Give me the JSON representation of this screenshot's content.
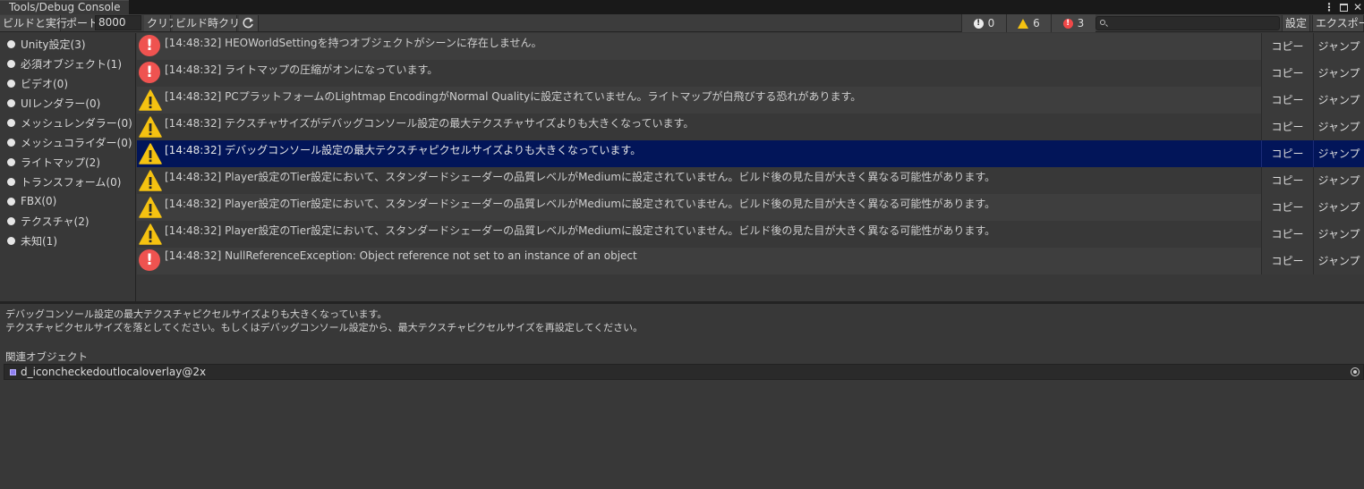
{
  "window": {
    "title": "Tools/Debug Console"
  },
  "toolbar": {
    "build_run_label": "ビルドと実行",
    "port_label": "ポート",
    "port_value": "8000",
    "clear_label": "クリア",
    "clear_on_build_label": "ビルド時クリア",
    "refresh_icon": "refresh-icon",
    "info_count": "0",
    "warning_count": "6",
    "error_count": "3",
    "search_placeholder": "",
    "settings_label": "設定",
    "export_label": "エクスポート"
  },
  "sidebar": {
    "items": [
      {
        "label": "Unity設定(3)"
      },
      {
        "label": "必須オブジェクト(1)"
      },
      {
        "label": "ビデオ(0)"
      },
      {
        "label": "UIレンダラー(0)"
      },
      {
        "label": "メッシュレンダラー(0)"
      },
      {
        "label": "メッシュコライダー(0)"
      },
      {
        "label": "ライトマップ(2)"
      },
      {
        "label": "トランスフォーム(0)"
      },
      {
        "label": "FBX(0)"
      },
      {
        "label": "テクスチャ(2)"
      },
      {
        "label": "未知(1)"
      }
    ]
  },
  "logs": {
    "copy_label": "コピー",
    "jump_label": "ジャンプ",
    "rows": [
      {
        "level": "error",
        "text": "[14:48:32] HEOWorldSettingを持つオブジェクトがシーンに存在しません。",
        "selected": false
      },
      {
        "level": "error",
        "text": "[14:48:32] ライトマップの圧縮がオンになっています。",
        "selected": false
      },
      {
        "level": "warning",
        "text": "[14:48:32] PCプラットフォームのLightmap EncodingがNormal Qualityに設定されていません。ライトマップが白飛びする恐れがあります。",
        "selected": false
      },
      {
        "level": "warning",
        "text": "[14:48:32] テクスチャサイズがデバッグコンソール設定の最大テクスチャサイズよりも大きくなっています。",
        "selected": false
      },
      {
        "level": "warning",
        "text": "[14:48:32] デバッグコンソール設定の最大テクスチャピクセルサイズよりも大きくなっています。",
        "selected": true
      },
      {
        "level": "warning",
        "text": "[14:48:32] Player設定のTier設定において、スタンダードシェーダーの品質レベルがMediumに設定されていません。ビルド後の見た目が大きく異なる可能性があります。",
        "selected": false
      },
      {
        "level": "warning",
        "text": "[14:48:32] Player設定のTier設定において、スタンダードシェーダーの品質レベルがMediumに設定されていません。ビルド後の見た目が大きく異なる可能性があります。",
        "selected": false
      },
      {
        "level": "warning",
        "text": "[14:48:32] Player設定のTier設定において、スタンダードシェーダーの品質レベルがMediumに設定されていません。ビルド後の見た目が大きく異なる可能性があります。",
        "selected": false
      },
      {
        "level": "error",
        "text": "[14:48:32] NullReferenceException: Object reference not set to an instance of an object",
        "selected": false
      }
    ]
  },
  "detail": {
    "line1": "デバッグコンソール設定の最大テクスチャピクセルサイズよりも大きくなっています。",
    "line2": "テクスチャピクセルサイズを落としてください。もしくはデバッグコンソール設定から、最大テクスチャピクセルサイズを再設定してください。",
    "related_label": "関連オブジェクト",
    "object_name": "d_iconcheckedoutlocaloverlay@2x"
  },
  "colors": {
    "selected_row": "#021559",
    "error": "#ef5350",
    "warning": "#f5c211"
  }
}
